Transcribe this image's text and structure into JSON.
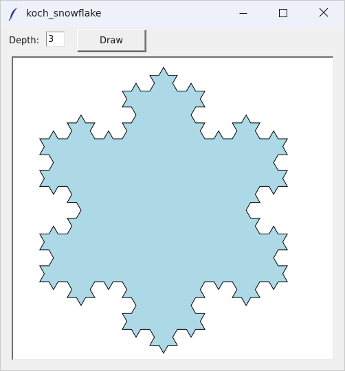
{
  "window": {
    "title": "koch_snowflake",
    "icon": "feather-icon",
    "controls": [
      "minimize-icon",
      "maximize-icon",
      "close-icon"
    ]
  },
  "toolbar": {
    "depth_label": "Depth:",
    "depth_value": "3",
    "draw_label": "Draw"
  },
  "canvas": {
    "shape": "koch-snowflake",
    "depth": 3,
    "fill_color": "#add8e6",
    "outline_color": "#000000",
    "background": "#ffffff"
  }
}
